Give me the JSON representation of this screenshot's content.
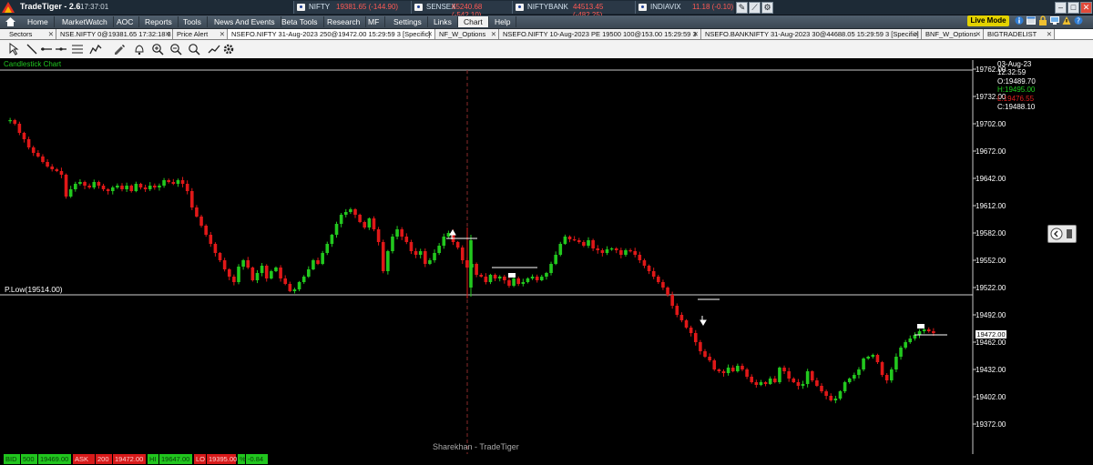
{
  "app": {
    "title": "TradeTiger - 2.6",
    "time": "17:37:01"
  },
  "tickers": [
    {
      "name": "NIFTY",
      "value": "19381.65 (-144.90)"
    },
    {
      "name": "SENSEX",
      "value": "65240.68 (-542.10)"
    },
    {
      "name": "NIFTYBANK",
      "value": "44513.45 (-482.25)"
    },
    {
      "name": "INDIAVIX",
      "value": "11.18 (-0.10)"
    }
  ],
  "menu": [
    "Home",
    "MarketWatch",
    "AOC",
    "Reports",
    "Tools",
    "News And Events",
    "Beta Tools",
    "Research",
    "MF",
    "Settings",
    "Links",
    "Chart",
    "Help"
  ],
  "live_mode": "Live Mode",
  "tabs": [
    "Sectors",
    "NSE.NIFTY 0@19381.65 17:32:18 3",
    "Price Alert",
    "NSEFO.NIFTY 31-Aug-2023 250@19472.00 15:29:59 3 [Specific]",
    "NF_W_Options",
    "NSEFO.NIFTY 10-Aug-2023 PE 19500 100@153.00 15:29:59 3",
    "NSEFO.BANKNIFTY 31-Aug-2023 30@44688.05 15:29:59 3 [Specific]",
    "BNF_W_Options",
    "BIGTRADELIST"
  ],
  "chart": {
    "label": "Candlestick Chart",
    "prev_low_label": "P.Low(19514.00)",
    "watermark": "Sharekhan - TradeTiger",
    "last_price": "19472.00",
    "ohlc": {
      "date": "03-Aug-23",
      "time": "12:32:59",
      "open": "O:19489.70",
      "high": "H:19495.00",
      "low": "L:19476.55",
      "close": "C:19488.10"
    }
  },
  "chart_data": {
    "type": "candlestick",
    "title": "Candlestick Chart",
    "y_ticks": [
      "19762.00",
      "19732.00",
      "19702.00",
      "19672.00",
      "19642.00",
      "19612.00",
      "19582.00",
      "19552.00",
      "19522.00",
      "19492.00",
      "19462.00",
      "19432.00",
      "19402.00",
      "19372.00"
    ],
    "ylim": [
      19350,
      19775
    ],
    "prev_low": 19514,
    "last_price": 19472,
    "close_path": [
      19705,
      19706,
      19702,
      19692,
      19685,
      19676,
      19670,
      19666,
      19660,
      19655,
      19652,
      19650,
      19646,
      19622,
      19630,
      19636,
      19638,
      19634,
      19632,
      19638,
      19634,
      19630,
      19628,
      19632,
      19634,
      19630,
      19634,
      19628,
      19636,
      19632,
      19630,
      19634,
      19632,
      19634,
      19640,
      19638,
      19636,
      19640,
      19636,
      19628,
      19610,
      19600,
      19590,
      19580,
      19570,
      19560,
      19552,
      19542,
      19534,
      19528,
      19545,
      19552,
      19544,
      19530,
      19538,
      19546,
      19532,
      19540,
      19544,
      19532,
      19526,
      19518,
      19520,
      19528,
      19534,
      19542,
      19552,
      19548,
      19560,
      19570,
      19580,
      19592,
      19602,
      19605,
      19608,
      19602,
      19594,
      19588,
      19598,
      19586,
      19572,
      19540,
      19562,
      19578,
      19586,
      19578,
      19572,
      19562,
      19558,
      19562,
      19548,
      19552,
      19560,
      19568,
      19578,
      19582,
      19572,
      19566,
      19552,
      19544,
      19548,
      19536,
      19534,
      19528,
      19536,
      19532,
      19534,
      19530,
      19524,
      19532,
      19526,
      19528,
      19532,
      19534,
      19530,
      19534,
      19538,
      19548,
      19558,
      19570,
      19578,
      19575,
      19574,
      19572,
      19568,
      19574,
      19565,
      19563,
      19560,
      19564,
      19565,
      19563,
      19558,
      19563,
      19562,
      19558,
      19552,
      19546,
      19540,
      19534,
      19528,
      19522,
      19514,
      19502,
      19492,
      19486,
      19478,
      19472,
      19462,
      19452,
      19446,
      19442,
      19432,
      19430,
      19428,
      19434,
      19430,
      19436,
      19432,
      19424,
      19418,
      19415,
      19418,
      19416,
      19422,
      19418,
      19434,
      19430,
      19422,
      19418,
      19414,
      19416,
      19430,
      19420,
      19414,
      19408,
      19403,
      19398,
      19400,
      19408,
      19418,
      19422,
      19426,
      19432,
      19444,
      19446,
      19448,
      19440,
      19426,
      19420,
      19432,
      19446,
      19456,
      19462,
      19466,
      19470,
      19474,
      19476,
      19474,
      19472
    ]
  },
  "status": [
    {
      "label": "BID",
      "value": "500"
    },
    {
      "label": "",
      "value": "19469.00"
    },
    {
      "label": "ASK",
      "value": "200"
    },
    {
      "label": "",
      "value": "19472.00"
    },
    {
      "label": "HI",
      "value": "19647.00"
    },
    {
      "label": "LO",
      "value": "19395.00"
    },
    {
      "label": "%",
      "value": "-0.84"
    }
  ]
}
